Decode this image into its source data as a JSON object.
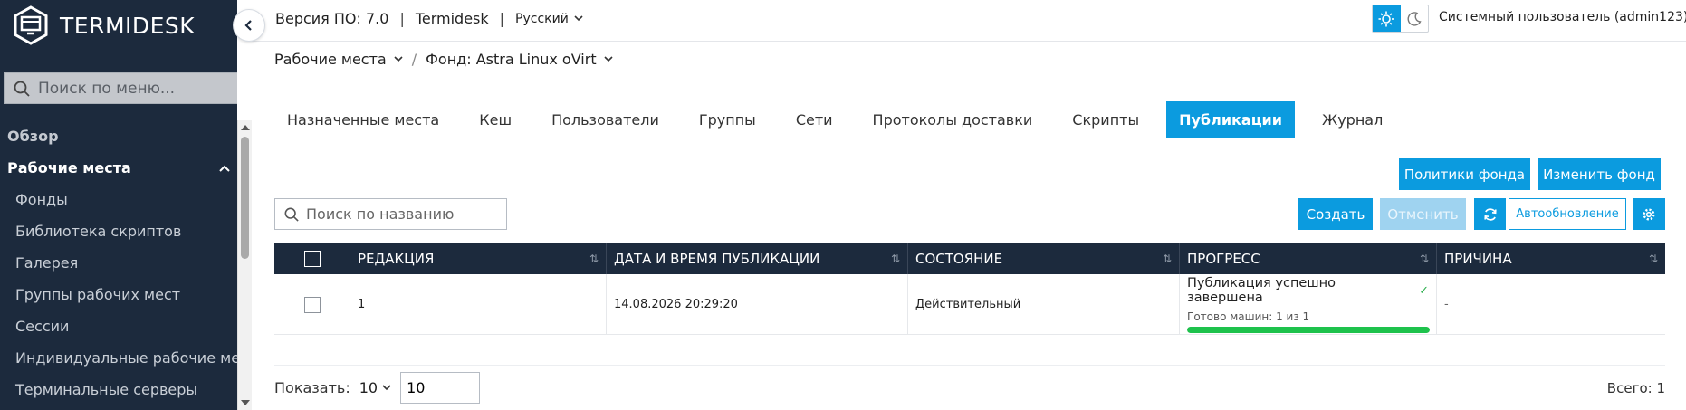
{
  "brand": {
    "name": "TERMIDESK"
  },
  "sidebar": {
    "search_placeholder": "Поиск по меню...",
    "items": [
      {
        "label": "Обзор"
      },
      {
        "label": "Рабочие места"
      },
      {
        "label": "Фонды"
      },
      {
        "label": "Библиотека скриптов"
      },
      {
        "label": "Галерея"
      },
      {
        "label": "Группы рабочих мест"
      },
      {
        "label": "Сессии"
      },
      {
        "label": "Индивидуальные рабочие места"
      },
      {
        "label": "Терминальные серверы"
      }
    ]
  },
  "header": {
    "version": "Версия ПО: 7.0",
    "product": "Termidesk",
    "language": "Русский",
    "user": "Системный пользователь (admin123)"
  },
  "breadcrumb": {
    "root": "Рабочие места",
    "current": "Фонд: Astra Linux oVirt"
  },
  "tabs": [
    {
      "label": "Назначенные места"
    },
    {
      "label": "Кеш"
    },
    {
      "label": "Пользователи"
    },
    {
      "label": "Группы"
    },
    {
      "label": "Сети"
    },
    {
      "label": "Протоколы доставки"
    },
    {
      "label": "Скрипты"
    },
    {
      "label": "Публикации"
    },
    {
      "label": "Журнал"
    }
  ],
  "actions": {
    "pool_policies": "Политики фонда",
    "edit_pool": "Изменить фонд",
    "create": "Создать",
    "cancel": "Отменить",
    "autorefresh": "Автообновление"
  },
  "search": {
    "placeholder": "Поиск по названию"
  },
  "table": {
    "columns": [
      "РЕДАКЦИЯ",
      "ДАТА И ВРЕМЯ ПУБЛИКАЦИИ",
      "СОСТОЯНИЕ",
      "ПРОГРЕСС",
      "ПРИЧИНА"
    ],
    "rows": [
      {
        "revision": "1",
        "datetime": "14.08.2026 20:29:20",
        "state": "Действительный",
        "progress_title": "Публикация успешно завершена",
        "progress_detail": "Готово машин: 1 из 1",
        "progress_fraction": 1.0,
        "reason": "-"
      }
    ]
  },
  "footer": {
    "show_label": "Показать:",
    "page_size": "10",
    "page_input": "10",
    "total": "Всего: 1"
  },
  "colors": {
    "accent": "#0b9bdf",
    "sidebar_bg": "#1c2a3d",
    "progress_green": "#1ec24c"
  }
}
